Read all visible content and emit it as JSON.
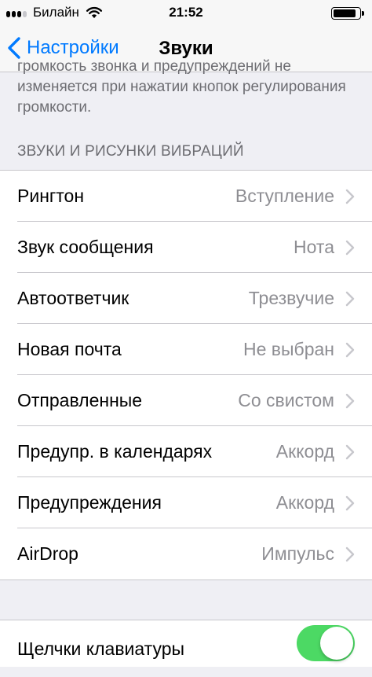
{
  "status": {
    "carrier": "Билайн",
    "time": "21:52"
  },
  "nav": {
    "back_label": "Настройки",
    "title": "Звуки"
  },
  "footer_text": "громкость звонка и предупреждений не изменяется при нажатии кнопок регулирования громкости.",
  "section_header": "ЗВУКИ И РИСУНКИ ВИБРАЦИЙ",
  "rows": [
    {
      "label": "Рингтон",
      "value": "Вступление"
    },
    {
      "label": "Звук сообщения",
      "value": "Нота"
    },
    {
      "label": "Автоответчик",
      "value": "Трезвучие"
    },
    {
      "label": "Новая почта",
      "value": "Не выбран"
    },
    {
      "label": "Отправленные",
      "value": "Со свистом"
    },
    {
      "label": "Предупр. в календарях",
      "value": "Аккорд"
    },
    {
      "label": "Предупреждения",
      "value": "Аккорд"
    },
    {
      "label": "AirDrop",
      "value": "Импульс"
    }
  ],
  "keyboard": {
    "label": "Щелчки клавиатуры",
    "on": true
  },
  "colors": {
    "accent": "#007aff",
    "toggle_on": "#4cd964",
    "secondary": "#8e8e93"
  }
}
